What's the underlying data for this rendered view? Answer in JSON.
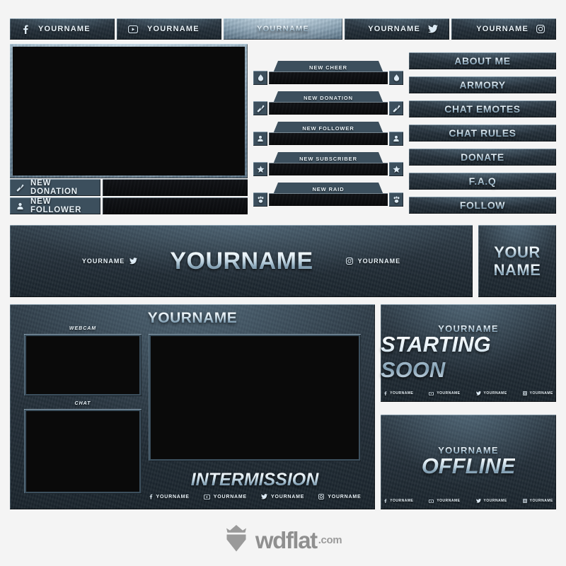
{
  "brand": {
    "name": "wdflat",
    "suffix": ".com",
    "logo_icon": "shield-crown-icon"
  },
  "placeholder_name": "YOURNAME",
  "top_bar": {
    "segments": [
      {
        "icon": "facebook-icon",
        "label": "YOURNAME",
        "align": "left",
        "tone": "dark"
      },
      {
        "icon": "youtube-icon",
        "label": "YOURNAME",
        "align": "left",
        "tone": "dark"
      },
      {
        "icon": "none",
        "label": "YOURNAME",
        "align": "center",
        "tone": "light"
      },
      {
        "icon": "twitter-icon",
        "label": "YOURNAME",
        "align": "right",
        "tone": "dark"
      },
      {
        "icon": "instagram-icon",
        "label": "YOURNAME",
        "align": "right",
        "tone": "dark"
      }
    ]
  },
  "capture": {
    "screen_label": "",
    "lower_thirds": [
      {
        "icon": "cheer-bits-icon",
        "label": "NEW DONATION"
      },
      {
        "icon": "user-icon",
        "label": "NEW FOLLOWER"
      }
    ]
  },
  "alerts": [
    {
      "label": "NEW CHEER",
      "icon": "diamond-icon"
    },
    {
      "label": "NEW DONATION",
      "icon": "money-icon"
    },
    {
      "label": "NEW FOLLOWER",
      "icon": "user-icon"
    },
    {
      "label": "NEW SUBSCRIBER",
      "icon": "star-icon"
    },
    {
      "label": "NEW RAID",
      "icon": "paw-icon"
    }
  ],
  "panels": [
    {
      "label": "ABOUT ME"
    },
    {
      "label": "ARMORY"
    },
    {
      "label": "CHAT EMOTES"
    },
    {
      "label": "CHAT RULES"
    },
    {
      "label": "DONATE"
    },
    {
      "label": "F.A.Q"
    },
    {
      "label": "FOLLOW"
    }
  ],
  "banner": {
    "left": {
      "label": "YOURNAME",
      "icon": "twitter-icon"
    },
    "title": "YOURNAME",
    "right": {
      "label": "YOURNAME",
      "icon": "instagram-icon"
    }
  },
  "avatar": {
    "line1": "YOUR",
    "line2": "NAME"
  },
  "intermission": {
    "title": "YOURNAME",
    "webcam_label": "WEBCAM",
    "chat_label": "CHAT",
    "heading": "INTERMISSION",
    "socials": [
      {
        "icon": "facebook-icon",
        "label": "YOURNAME"
      },
      {
        "icon": "youtube-icon",
        "label": "YOURNAME"
      },
      {
        "icon": "twitter-icon",
        "label": "YOURNAME"
      },
      {
        "icon": "instagram-icon",
        "label": "YOURNAME"
      }
    ]
  },
  "starting_soon": {
    "sub": "YOURNAME",
    "heading": "STARTING SOON",
    "socials": [
      {
        "icon": "facebook-icon",
        "label": "YOURNAME"
      },
      {
        "icon": "youtube-icon",
        "label": "YOURNAME"
      },
      {
        "icon": "twitter-icon",
        "label": "YOURNAME"
      },
      {
        "icon": "instagram-icon",
        "label": "YOURNAME"
      }
    ]
  },
  "offline": {
    "sub": "YOURNAME",
    "heading": "OFFLINE",
    "socials": [
      {
        "icon": "facebook-icon",
        "label": "YOURNAME"
      },
      {
        "icon": "youtube-icon",
        "label": "YOURNAME"
      },
      {
        "icon": "twitter-icon",
        "label": "YOURNAME"
      },
      {
        "icon": "instagram-icon",
        "label": "YOURNAME"
      }
    ]
  },
  "colors": {
    "page_bg": "#f4f4f4",
    "metal_dark": "#26313b",
    "metal_mid": "#3c4f5d",
    "metal_light": "#7d98aa",
    "screen_black": "#0a0a0a",
    "text_light": "#e9f3f9",
    "logo_gray": "#8f8f8f"
  }
}
